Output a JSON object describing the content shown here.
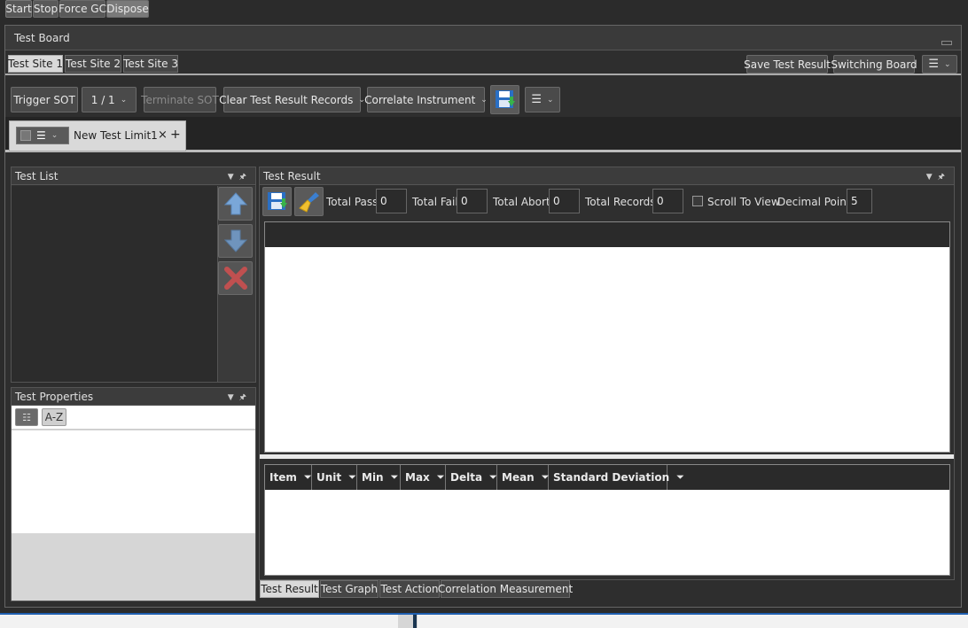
{
  "top_buttons": [
    "Start",
    "Stop",
    "Force GC",
    "Dispose"
  ],
  "board": {
    "title": "Test Board"
  },
  "site_tabs": [
    "Test Site 1",
    "Test Site 2",
    "Test Site 3"
  ],
  "site_actions": {
    "save": "Save Test Result",
    "switching": "Switching Board"
  },
  "toolbar": {
    "trigger": "Trigger SOT",
    "count": "1 / 1",
    "terminate": "Terminate SOT",
    "clear": "Clear Test Result Records",
    "correlate": "Correlate Instrument"
  },
  "limit_tab": {
    "name": "New Test Limit1",
    "close": "×",
    "add": "+"
  },
  "test_list": {
    "title": "Test List"
  },
  "test_props": {
    "title": "Test Properties",
    "sort": "A-Z"
  },
  "result": {
    "title": "Test Result",
    "total_pass_label": "Total Pass:",
    "total_pass": "0",
    "total_fail_label": "Total Fail:",
    "total_fail": "0",
    "total_abort_label": "Total Abort:",
    "total_abort": "0",
    "total_records_label": "Total Records:",
    "total_records": "0",
    "scroll_label": "Scroll To View",
    "decimal_label": "Decimal Point:",
    "decimal": "5"
  },
  "stats_columns": [
    "Item",
    "Unit",
    "Min",
    "Max",
    "Delta",
    "Mean",
    "Standard Deviation"
  ],
  "bottom_tabs": [
    "Test Result",
    "Test Graph",
    "Test Action",
    "Correlation Measurement"
  ],
  "colors": {
    "background": "#2b2b2b",
    "panel": "#3c3c3c",
    "active_tab": "#d9d9d9",
    "accent_blue": "#1f5fb0"
  }
}
